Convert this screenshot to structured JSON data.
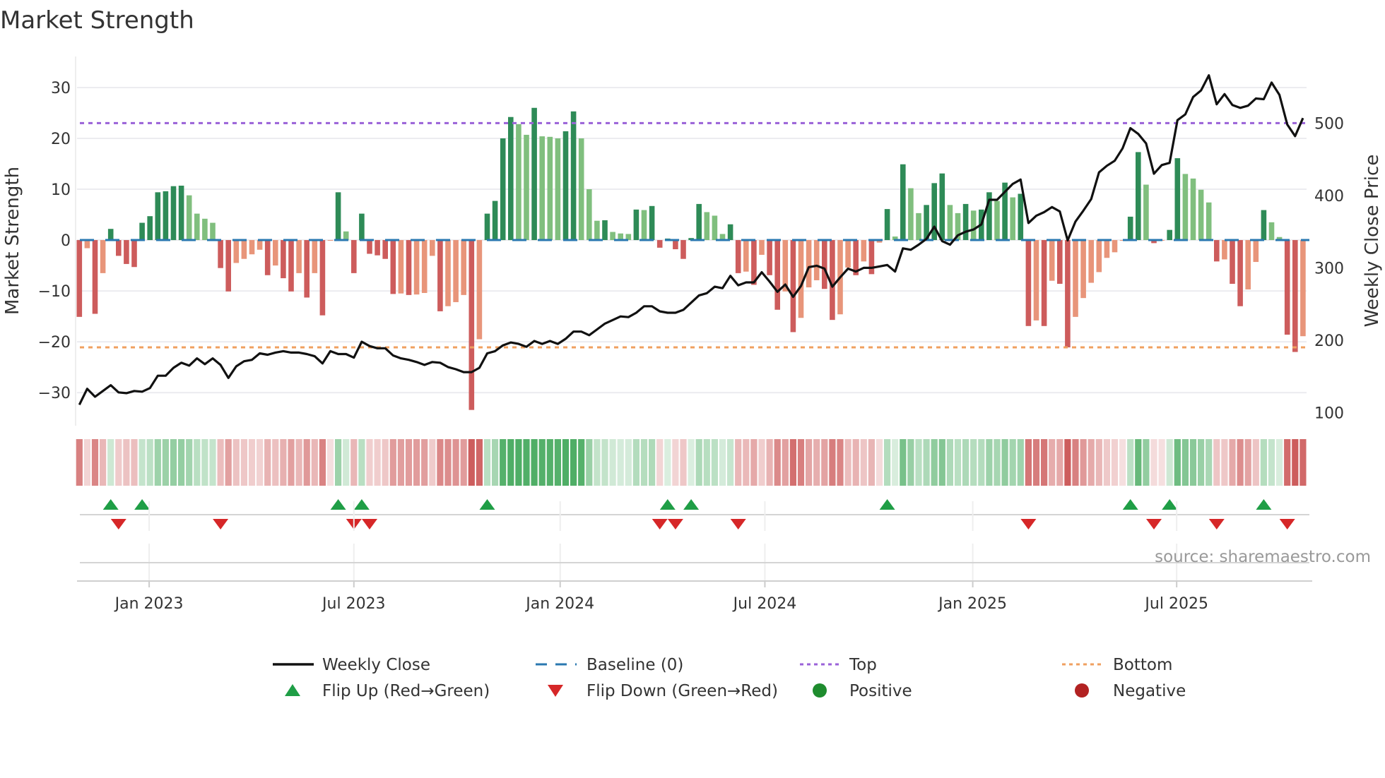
{
  "chart_data": {
    "type": "bar",
    "title": "Market Strength",
    "ylabel": "Market Strength",
    "y2label": "Weekly Close Price",
    "ylim": [
      -36.5,
      36.1
    ],
    "y2lim": [
      82,
      592
    ],
    "yticks": [
      30,
      20,
      10,
      0,
      -10,
      -20,
      -30
    ],
    "yticklabels": [
      "30",
      "20",
      "10",
      "0",
      "−10",
      "−20",
      "−30"
    ],
    "y2ticks": [
      500,
      400,
      300,
      200,
      100
    ],
    "y2ticklabels": [
      "500",
      "400",
      "300",
      "200",
      "100"
    ],
    "xticks": [
      {
        "label": "Jan 2023",
        "x": 8.9
      },
      {
        "label": "Jul 2023",
        "x": 35.0
      },
      {
        "label": "Jan 2024",
        "x": 61.3
      },
      {
        "label": "Jul 2024",
        "x": 87.4
      },
      {
        "label": "Jan 2025",
        "x": 113.9
      },
      {
        "label": "Jul 2025",
        "x": 139.9
      }
    ],
    "grid": true,
    "top_level": 23.0,
    "bottom_level": -21.1,
    "baseline": 0,
    "strength": [
      -15.1,
      -1.6,
      -14.5,
      -6.5,
      2.2,
      -3.1,
      -4.7,
      -5.3,
      3.4,
      4.7,
      9.4,
      9.6,
      10.6,
      10.7,
      8.8,
      5.2,
      4.2,
      3.4,
      -5.5,
      -10.1,
      -4.5,
      -3.7,
      -2.8,
      -1.9,
      -6.9,
      -5.0,
      -7.5,
      -10.1,
      -6.5,
      -11.3,
      -6.5,
      -14.8,
      -0.1,
      9.4,
      1.7,
      -6.5,
      5.2,
      -2.7,
      -3.0,
      -3.7,
      -10.6,
      -10.5,
      -10.8,
      -10.7,
      -10.4,
      -3.1,
      -14.0,
      -13.0,
      -12.2,
      -10.8,
      -33.4,
      -19.5,
      5.2,
      7.7,
      20.0,
      24.2,
      22.8,
      20.7,
      26.0,
      20.4,
      20.3,
      20.0,
      21.4,
      25.3,
      20.0,
      10.0,
      3.8,
      3.9,
      1.6,
      1.3,
      1.2,
      6.0,
      5.9,
      6.7,
      -1.5,
      0.3,
      -1.8,
      -3.7,
      0.4,
      7.1,
      5.5,
      4.8,
      1.2,
      3.1,
      -6.5,
      -6.2,
      -8.8,
      -2.9,
      -6.9,
      -13.7,
      -10.1,
      -18.1,
      -15.3,
      -9.3,
      -7.9,
      -9.6,
      -15.7,
      -14.6,
      -5.4,
      -6.9,
      -4.2,
      -6.7,
      -0.5,
      6.1,
      0.7,
      14.9,
      10.2,
      5.3,
      6.9,
      11.2,
      13.1,
      6.9,
      5.3,
      7.1,
      5.8,
      6.0,
      9.4,
      7.7,
      11.3,
      8.4,
      9.1,
      -16.9,
      -15.8,
      -16.9,
      -8.0,
      -8.6,
      -21.1,
      -15.1,
      -11.4,
      -8.4,
      -6.3,
      -3.5,
      -2.4,
      -0.1,
      4.6,
      17.3,
      10.9,
      -0.6,
      -0.1,
      2.0,
      16.1,
      13.0,
      12.1,
      9.9,
      7.4,
      -4.2,
      -3.8,
      -8.6,
      -13.0,
      -9.7,
      -4.3,
      5.9,
      3.5,
      0.6,
      -18.6,
      -22.0,
      -18.9
    ],
    "weekly_close": [
      111,
      133,
      122,
      130,
      138,
      128,
      127,
      130,
      129,
      134,
      151,
      151,
      162,
      169,
      165,
      175,
      167,
      175,
      166,
      148,
      164,
      171,
      173,
      182,
      180,
      183,
      185,
      183,
      183,
      181,
      178,
      168,
      185,
      181,
      181,
      176,
      198,
      192,
      189,
      189,
      179,
      175,
      173,
      170,
      166,
      170,
      169,
      163,
      160,
      156,
      156,
      162,
      182,
      185,
      193,
      197,
      195,
      191,
      199,
      195,
      199,
      195,
      202,
      212,
      212,
      207,
      215,
      223,
      228,
      233,
      232,
      238,
      247,
      247,
      240,
      238,
      238,
      242,
      252,
      262,
      265,
      274,
      272,
      289,
      276,
      280,
      280,
      294,
      281,
      267,
      277,
      260,
      275,
      301,
      303,
      299,
      274,
      287,
      299,
      295,
      300,
      300,
      302,
      304,
      295,
      327,
      325,
      332,
      340,
      357,
      337,
      332,
      345,
      350,
      353,
      360,
      394,
      394,
      405,
      416,
      422,
      362,
      372,
      377,
      384,
      378,
      338,
      364,
      379,
      395,
      432,
      441,
      448,
      465,
      493,
      485,
      472,
      430,
      442,
      445,
      504,
      512,
      536,
      545,
      566,
      526,
      540,
      525,
      521,
      524,
      534,
      533,
      556,
      539,
      498,
      482,
      507
    ],
    "flip_up_indices": [
      4,
      8,
      33,
      36,
      52,
      75,
      78,
      103,
      134,
      139,
      151
    ],
    "flip_down_indices": [
      5,
      18,
      35,
      37,
      74,
      76,
      84,
      121,
      137,
      145,
      154
    ],
    "legend": {
      "placement": "bottom",
      "items": [
        {
          "label": "Weekly Close",
          "kind": "line"
        },
        {
          "label": "Baseline (0)",
          "kind": "dash"
        },
        {
          "label": "Top",
          "kind": "dot-purple"
        },
        {
          "label": "Bottom",
          "kind": "dot-orange"
        },
        {
          "label": "Flip Up (Red→Green)",
          "kind": "tri-up"
        },
        {
          "label": "Flip Down (Green→Red)",
          "kind": "tri-down"
        },
        {
          "label": "Positive",
          "kind": "circle-green"
        },
        {
          "label": "Negative",
          "kind": "circle-red"
        }
      ]
    },
    "annotation": "source: sharemaestro.com",
    "colors": {
      "pos_rising": "#2e8b57",
      "pos_falling": "#80bf7e",
      "neg_falling": "#cd5c5c",
      "neg_rising": "#e8957a",
      "price": "#111111",
      "baseline": "#2a78b0",
      "top": "#9a62d8",
      "bottom": "#f0a060",
      "flip_up": "#1f9e46",
      "flip_down": "#d62728",
      "positive": "#1e8c2e",
      "negative": "#b22222",
      "grid": "#ececf0"
    }
  }
}
